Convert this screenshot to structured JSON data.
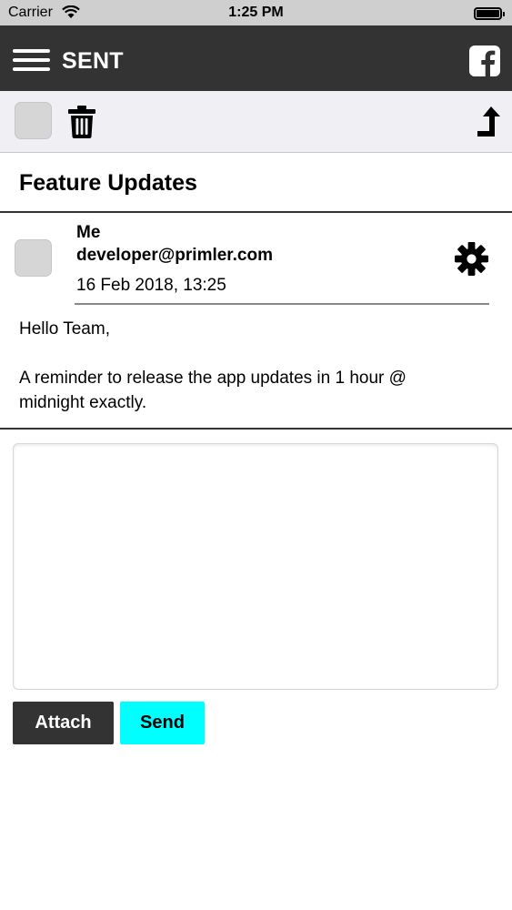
{
  "status_bar": {
    "carrier": "Carrier",
    "time": "1:25 PM"
  },
  "header": {
    "title": "SENT",
    "menu_icon": "hamburger-icon",
    "social_icon": "facebook-icon"
  },
  "toolbar": {
    "delete_icon": "trash-icon",
    "share_icon": "share-arrow-icon"
  },
  "message": {
    "subject": "Feature Updates",
    "sender_name": "Me",
    "sender_email": "developer@primler.com",
    "date": "16 Feb 2018, 13:25",
    "body": {
      "greeting": "Hello Team,",
      "line1": "A reminder to release the app updates in 1 hour @",
      "line2": "midnight exactly."
    }
  },
  "reply": {
    "value": ""
  },
  "actions": {
    "attach_label": "Attach",
    "send_label": "Send"
  },
  "colors": {
    "header_bg": "#333333",
    "send_accent": "#00ffff",
    "toolbar_bg": "#f0eff4"
  }
}
